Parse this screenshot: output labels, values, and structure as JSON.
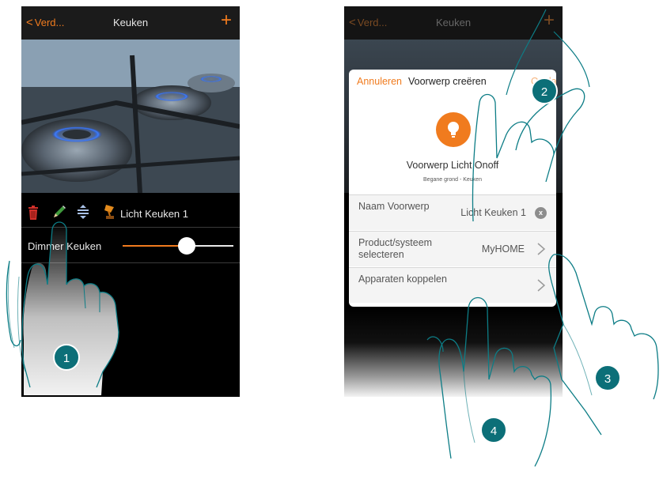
{
  "phone1": {
    "header": {
      "back_label": "Verd...",
      "title": "Keuken",
      "add_symbol": "+"
    },
    "toolbar": {
      "item_name": "Licht Keuken 1"
    },
    "dimmer": {
      "label": "Dimmer Keuken",
      "level_percent": 58
    }
  },
  "phone2": {
    "header": {
      "back_label": "Verd...",
      "title": "Keuken",
      "add_symbol": "+"
    },
    "dialog": {
      "cancel_label": "Annuleren",
      "title": "Voorwerp creëren",
      "save_label": "Opslaan",
      "object_name": "Voorwerp Licht Onoff",
      "object_location": "Begane grond - Keuken",
      "rows": [
        {
          "label": "Naam Voorwerp",
          "value": "Licht Keuken 1",
          "action": "clear"
        },
        {
          "label": "Product/systeem selecteren",
          "value": "MyHOME",
          "action": "chevron"
        },
        {
          "label": "Apparaten koppelen",
          "value": "",
          "action": "chevron"
        }
      ],
      "clear_symbol": "x"
    }
  },
  "steps": [
    "1",
    "2",
    "3",
    "4"
  ],
  "colors": {
    "accent": "#f07b1e",
    "badge": "#0c6f78",
    "hand_outline": "#0d7d86"
  },
  "icons": [
    "trash-icon",
    "pencil-icon",
    "move-icon",
    "lamp-icon",
    "bulb-icon",
    "chevron-right-icon",
    "clear-icon"
  ]
}
